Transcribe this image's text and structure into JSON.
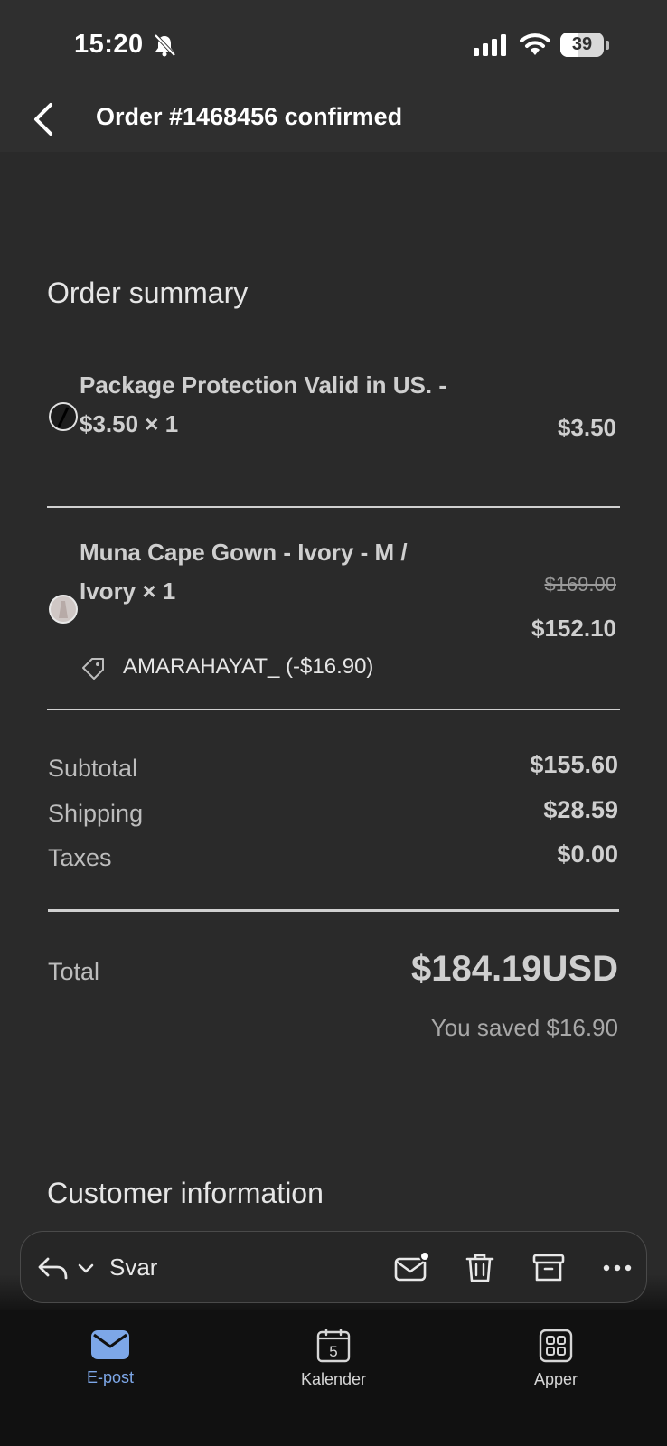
{
  "status_bar": {
    "time": "15:20",
    "battery_level": "39",
    "battery_fraction": 0.39
  },
  "header": {
    "title": "Order #1468456 confirmed"
  },
  "order_summary": {
    "title": "Order summary",
    "items": [
      {
        "line1": "Package Protection Valid in US. -",
        "line2": "$3.50 × 1",
        "price": "$3.50"
      },
      {
        "line1": "Muna Cape Gown - Ivory - M /",
        "line2": "Ivory × 1",
        "original_price": "$169.00",
        "price": "$152.10",
        "discount_code": "AMARAHAYAT_ (-$16.90)"
      }
    ],
    "subtotal_label": "Subtotal",
    "subtotal_value": "$155.60",
    "shipping_label": "Shipping",
    "shipping_value": "$28.59",
    "taxes_label": "Taxes",
    "taxes_value": "$0.00",
    "total_label": "Total",
    "total_value": "$184.19USD",
    "saved_text": "You saved $16.90"
  },
  "customer_info": {
    "title": "Customer information"
  },
  "toolbar": {
    "reply_label": "Svar"
  },
  "tab_bar": {
    "tabs": [
      {
        "label": "E-post",
        "active": true
      },
      {
        "label": "Kalender",
        "calendar_day": "5"
      },
      {
        "label": "Apper"
      }
    ]
  },
  "colors": {
    "accent": "#7da7e8",
    "background": "#2a2a2a",
    "header": "#2f2f2f"
  }
}
